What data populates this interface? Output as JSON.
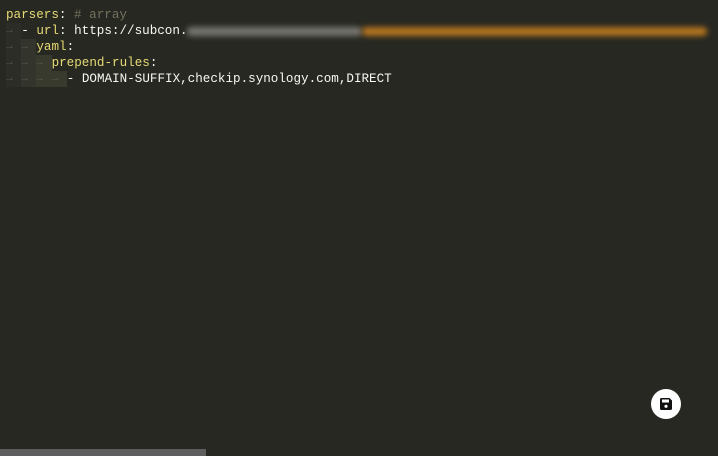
{
  "editor": {
    "lines": [
      {
        "key": "parsers",
        "colon": ":",
        "comment": " # array"
      },
      {
        "dash": "- ",
        "key": "url",
        "colon": ":",
        "value": " https://subcon."
      },
      {
        "key": "yaml",
        "colon": ":"
      },
      {
        "key": "prepend-rules",
        "colon": ":"
      },
      {
        "dash": "- ",
        "value": "DOMAIN-SUFFIX,checkip.synology.com,DIRECT"
      }
    ],
    "indent_glyph": "→"
  },
  "save_button": {
    "icon": "floppy-disk-icon"
  },
  "colors": {
    "background": "#272822",
    "key": "#e6db74",
    "comment": "#75715e",
    "text": "#f8f8f2"
  }
}
